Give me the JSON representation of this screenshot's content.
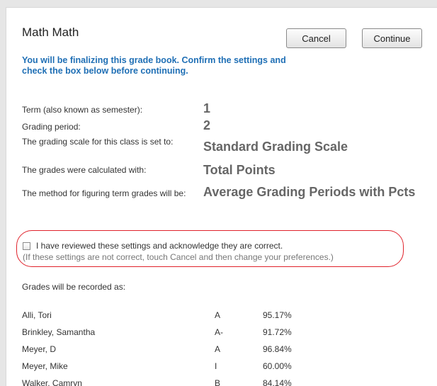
{
  "dialog": {
    "title": "Math Math",
    "cancel_label": "Cancel",
    "continue_label": "Continue",
    "notice": "You will be finalizing this grade book.  Confirm the settings and check the box below before continuing."
  },
  "settings": [
    {
      "label": "Term (also known as semester):",
      "value": "1"
    },
    {
      "label": "Grading period:",
      "value": "2"
    },
    {
      "label": "The grading scale for this class is set to:",
      "value": "Standard Grading Scale"
    },
    {
      "label": "The grades were calculated with:",
      "value": "Total Points"
    },
    {
      "label": "The method for figuring term grades will be:",
      "value": "Average Grading Periods with Pcts"
    }
  ],
  "acknowledge": {
    "checked": false,
    "label": "I have reviewed these settings and acknowledge they are correct.",
    "hint": "(If these settings are not correct, touch Cancel and then change your preferences.)"
  },
  "grades_heading": "Grades will be recorded as:",
  "grades": [
    {
      "name": "Alli, Tori",
      "letter": "A",
      "percent": "95.17%"
    },
    {
      "name": "Brinkley, Samantha",
      "letter": "A-",
      "percent": "91.72%"
    },
    {
      "name": "Meyer, D",
      "letter": "A",
      "percent": "96.84%"
    },
    {
      "name": "Meyer, Mike",
      "letter": "I",
      "percent": "60.00%"
    },
    {
      "name": "Walker, Camryn",
      "letter": "B",
      "percent": "84.14%"
    }
  ],
  "colors": {
    "notice": "#1f6fb5",
    "value_text": "#666666",
    "highlight_ring": "#e0222b"
  }
}
